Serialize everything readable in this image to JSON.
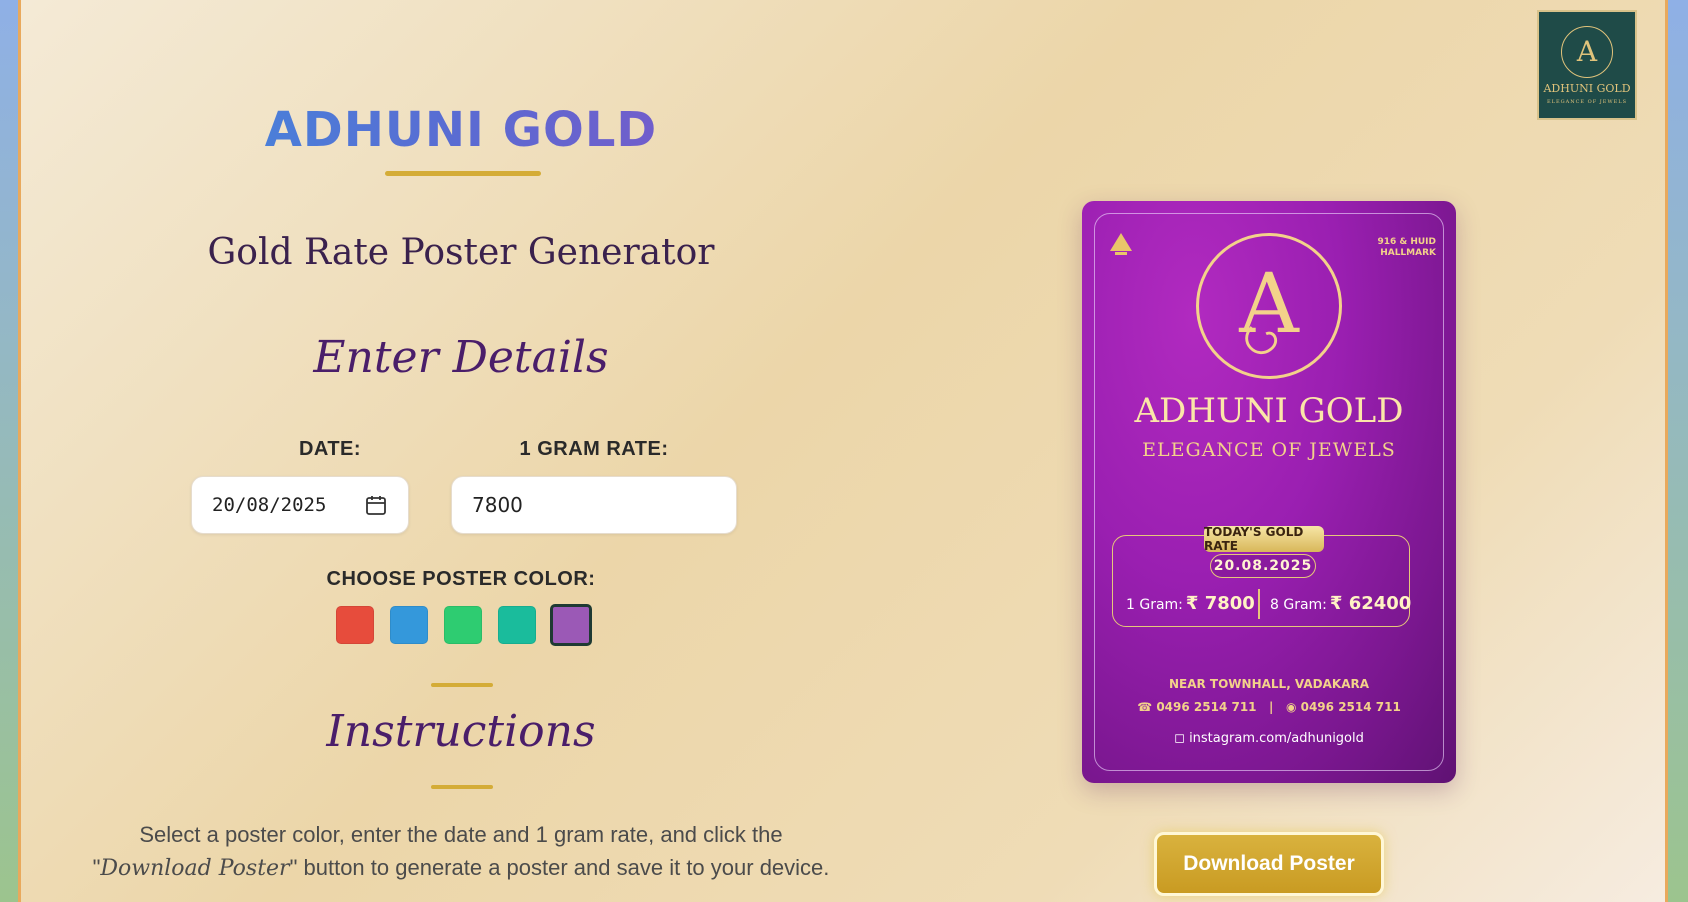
{
  "brand": {
    "title": "ADHUNI GOLD",
    "logo_name": "ADHUNI GOLD",
    "logo_tagline": "ELEGANCE OF JEWELS",
    "logo_letter": "A"
  },
  "subtitle": "Gold Rate Poster Generator",
  "form": {
    "heading": "Enter Details",
    "date_label": "DATE:",
    "date_value": "20/08/2025",
    "rate_label": "1 GRAM RATE:",
    "rate_value": "7800",
    "color_label": "CHOOSE POSTER COLOR:",
    "colors": [
      "#e74c3c",
      "#3498db",
      "#2ecc71",
      "#1abc9c",
      "#9b59b6"
    ],
    "selected_color": "#9b59b6"
  },
  "instructions": {
    "heading": "Instructions",
    "text_before": "Select a poster color, enter the date and 1 gram rate, and click the \"",
    "text_emph": "Download Poster",
    "text_after": "\" button to generate a poster and save it to your device."
  },
  "poster": {
    "hallmark": "916 & HUID\nHALLMARK",
    "letter": "A",
    "name": "ADHUNI GOLD",
    "tagline": "ELEGANCE OF JEWELS",
    "rate_title": "TODAY'S GOLD RATE",
    "date": "20.08.2025",
    "gram1_label": "1 Gram:",
    "gram1_value": "₹ 7800",
    "gram8_label": "8 Gram:",
    "gram8_value": "₹ 62400",
    "address": "NEAR TOWNHALL, VADAKARA",
    "phone": "☎ 0496 2514 711   |   ◉ 0496 2514 711",
    "instagram": "instagram.com/adhunigold"
  },
  "download_button": "Download Poster"
}
